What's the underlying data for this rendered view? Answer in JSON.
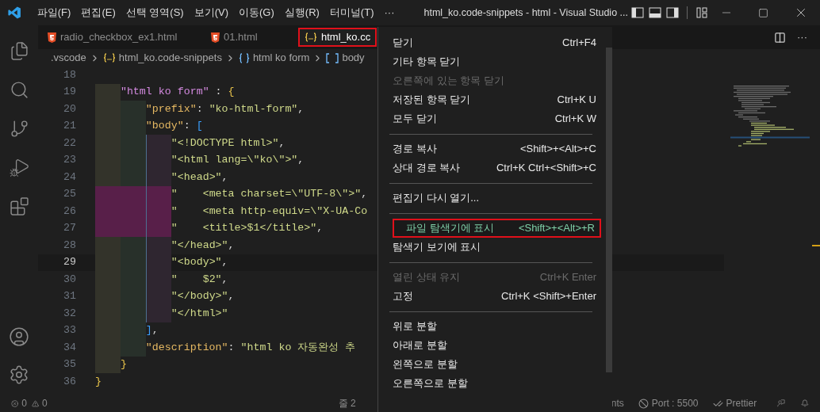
{
  "title_bar": {
    "menu": [
      "파일(F)",
      "편집(E)",
      "선택 영역(S)",
      "보기(V)",
      "이동(G)",
      "실행(R)",
      "터미널(T)",
      "···"
    ],
    "title": "html_ko.code-snippets - html - Visual Studio ..."
  },
  "tabs": [
    {
      "label": "radio_checkbox_ex1.html",
      "kind": "html",
      "selected": false
    },
    {
      "label": "01.html",
      "kind": "html",
      "selected": false
    },
    {
      "label": "html_ko.cc",
      "kind": "json",
      "selected": true
    }
  ],
  "editor_actions": [
    "···"
  ],
  "breadcrumb": [
    {
      "label": ".vscode",
      "kind": "folder"
    },
    {
      "label": "html_ko.code-snippets",
      "kind": "json"
    },
    {
      "label": "html ko form",
      "kind": "object"
    },
    {
      "label": "body",
      "kind": "array"
    }
  ],
  "code": [
    {
      "number": "18",
      "current": false
    },
    {
      "number": "19",
      "current": false,
      "indent_error": false,
      "tokens": [
        {
          "kind": "name",
          "text": "    \"html ko form\""
        },
        {
          "kind": "punct",
          "text": " : "
        },
        {
          "kind": "brace",
          "text": "{"
        }
      ]
    },
    {
      "number": "20",
      "current": false,
      "indent_error": false,
      "tokens": [
        {
          "kind": "key",
          "text": "        \"prefix\""
        },
        {
          "kind": "punct",
          "text": ": "
        },
        {
          "kind": "string",
          "text": "\"ko-html-form\""
        },
        {
          "kind": "punct",
          "text": ","
        }
      ]
    },
    {
      "number": "21",
      "current": false,
      "indent_error": false,
      "tokens": [
        {
          "kind": "key",
          "text": "        \"body\""
        },
        {
          "kind": "punct",
          "text": ": "
        },
        {
          "kind": "bracket",
          "text": "["
        }
      ]
    },
    {
      "number": "22",
      "current": false,
      "indent_error": false,
      "tokens": [
        {
          "kind": "string",
          "text": "            \"<!DOCTYPE html>\""
        },
        {
          "kind": "punct",
          "text": ","
        }
      ]
    },
    {
      "number": "23",
      "current": false,
      "indent_error": false,
      "tokens": [
        {
          "kind": "string",
          "text": "            \"<html lang=\\\"ko\\\">\""
        },
        {
          "kind": "punct",
          "text": ","
        }
      ]
    },
    {
      "number": "24",
      "current": false,
      "indent_error": false,
      "tokens": [
        {
          "kind": "string",
          "text": "            \"<head>\""
        },
        {
          "kind": "punct",
          "text": ","
        }
      ]
    },
    {
      "number": "25",
      "current": false,
      "indent_error": true,
      "tokens": [
        {
          "kind": "string",
          "text": "            \"    <meta charset=\\\"UTF-8\\\">\""
        },
        {
          "kind": "punct",
          "text": ","
        }
      ]
    },
    {
      "number": "26",
      "current": false,
      "indent_error": true,
      "tokens": [
        {
          "kind": "string",
          "text": "            \"    <meta http-equiv=\\\"X-UA-Co"
        }
      ]
    },
    {
      "number": "27",
      "current": false,
      "indent_error": true,
      "tokens": [
        {
          "kind": "string",
          "text": "            \"    <title>$1</title>\""
        },
        {
          "kind": "punct",
          "text": ","
        }
      ]
    },
    {
      "number": "28",
      "current": false,
      "indent_error": false,
      "tokens": [
        {
          "kind": "string",
          "text": "            \"</head>\""
        },
        {
          "kind": "punct",
          "text": ","
        }
      ]
    },
    {
      "number": "29",
      "current": true,
      "indent_error": false,
      "tokens": [
        {
          "kind": "string",
          "text": "            \"<body>\""
        },
        {
          "kind": "punct",
          "text": ","
        }
      ]
    },
    {
      "number": "30",
      "current": false,
      "indent_error": false,
      "tokens": [
        {
          "kind": "string",
          "text": "            \"    $2\""
        },
        {
          "kind": "punct",
          "text": ","
        }
      ]
    },
    {
      "number": "31",
      "current": false,
      "indent_error": false,
      "tokens": [
        {
          "kind": "string",
          "text": "            \"</body>\""
        },
        {
          "kind": "punct",
          "text": ","
        }
      ]
    },
    {
      "number": "32",
      "current": false,
      "indent_error": false,
      "tokens": [
        {
          "kind": "string",
          "text": "            \"</html>\""
        }
      ]
    },
    {
      "number": "33",
      "current": false,
      "indent_error": false,
      "tokens": [
        {
          "kind": "bracket",
          "text": "        ]"
        },
        {
          "kind": "punct",
          "text": ","
        }
      ]
    },
    {
      "number": "34",
      "current": false,
      "indent_error": false,
      "tokens": [
        {
          "kind": "key",
          "text": "        \"description\""
        },
        {
          "kind": "punct",
          "text": ": "
        },
        {
          "kind": "string",
          "text": "\"html ko 자동완성 추"
        }
      ]
    },
    {
      "number": "35",
      "current": false,
      "indent_error": false,
      "tokens": [
        {
          "kind": "brace",
          "text": "    }"
        }
      ]
    },
    {
      "number": "36",
      "current": false,
      "tokens": [
        {
          "kind": "brace",
          "text": "}"
        }
      ]
    }
  ],
  "context_menu": [
    {
      "kind": "item",
      "label": "닫기",
      "shortcut": "Ctrl+F4",
      "disabled": false,
      "selected": false
    },
    {
      "kind": "item",
      "label": "기타 항목 닫기",
      "disabled": false,
      "selected": false
    },
    {
      "kind": "item",
      "label": "오른쪽에 있는 항목 닫기",
      "disabled": true,
      "selected": false
    },
    {
      "kind": "item",
      "label": "저장된 항목 닫기",
      "shortcut": "Ctrl+K U",
      "disabled": false,
      "selected": false
    },
    {
      "kind": "item",
      "label": "모두 닫기",
      "shortcut": "Ctrl+K W",
      "disabled": false,
      "selected": false
    },
    {
      "kind": "separator"
    },
    {
      "kind": "item",
      "label": "경로 복사",
      "shortcut": "<Shift>+<Alt>+C",
      "disabled": false,
      "selected": false
    },
    {
      "kind": "item",
      "label": "상대 경로 복사",
      "shortcut": "Ctrl+K Ctrl+<Shift>+C",
      "disabled": false,
      "selected": false
    },
    {
      "kind": "separator"
    },
    {
      "kind": "item",
      "label": "편집기 다시 열기...",
      "disabled": false,
      "selected": false
    },
    {
      "kind": "separator"
    },
    {
      "kind": "item",
      "label": "파일 탐색기에 표시",
      "shortcut": "<Shift>+<Alt>+R",
      "disabled": false,
      "selected": true
    },
    {
      "kind": "item",
      "label": "탐색기 보기에 표시",
      "disabled": false,
      "selected": false
    },
    {
      "kind": "separator"
    },
    {
      "kind": "item",
      "label": "열린 상태 유지",
      "shortcut": "Ctrl+K Enter",
      "disabled": true,
      "selected": false
    },
    {
      "kind": "item",
      "label": "고정",
      "shortcut": "Ctrl+K <Shift>+Enter",
      "disabled": false,
      "selected": false
    },
    {
      "kind": "separator"
    },
    {
      "kind": "item",
      "label": "위로 분할",
      "disabled": false,
      "selected": false
    },
    {
      "kind": "item",
      "label": "아래로 분할",
      "disabled": false,
      "selected": false
    },
    {
      "kind": "item",
      "label": "왼쪽으로 분할",
      "disabled": false,
      "selected": false
    },
    {
      "kind": "item",
      "label": "오른쪽으로 분할",
      "disabled": false,
      "selected": false
    }
  ],
  "status_bar": {
    "errors": "0",
    "warnings": "0",
    "position": "줄 2",
    "right": [
      {
        "kind": "text",
        "label": "nts"
      },
      {
        "kind": "port",
        "label": "Port : 5500"
      },
      {
        "kind": "prettier",
        "label": "Prettier"
      }
    ]
  }
}
